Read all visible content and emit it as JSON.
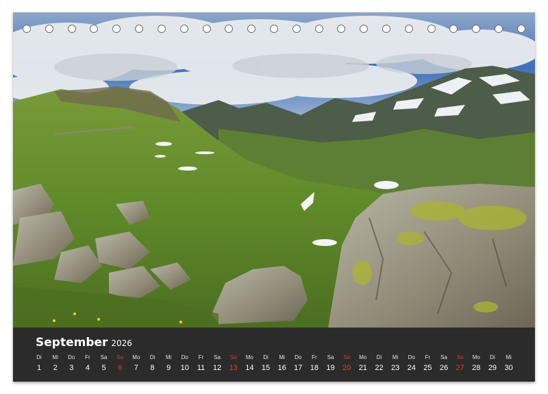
{
  "calendar": {
    "month": "September",
    "year": "2026",
    "sunday_color": "#e23a2d",
    "days": [
      {
        "wd": "Di",
        "n": "1"
      },
      {
        "wd": "Mi",
        "n": "2"
      },
      {
        "wd": "Do",
        "n": "3"
      },
      {
        "wd": "Fr",
        "n": "4"
      },
      {
        "wd": "Sa",
        "n": "5"
      },
      {
        "wd": "So",
        "n": "6"
      },
      {
        "wd": "Mo",
        "n": "7"
      },
      {
        "wd": "Di",
        "n": "8"
      },
      {
        "wd": "Mi",
        "n": "9"
      },
      {
        "wd": "Do",
        "n": "10"
      },
      {
        "wd": "Fr",
        "n": "11"
      },
      {
        "wd": "Sa",
        "n": "12"
      },
      {
        "wd": "So",
        "n": "13"
      },
      {
        "wd": "Mo",
        "n": "14"
      },
      {
        "wd": "Di",
        "n": "15"
      },
      {
        "wd": "Mi",
        "n": "16"
      },
      {
        "wd": "Do",
        "n": "17"
      },
      {
        "wd": "Fr",
        "n": "18"
      },
      {
        "wd": "Sa",
        "n": "19"
      },
      {
        "wd": "So",
        "n": "20"
      },
      {
        "wd": "Mo",
        "n": "21"
      },
      {
        "wd": "Di",
        "n": "22"
      },
      {
        "wd": "Mi",
        "n": "23"
      },
      {
        "wd": "Do",
        "n": "24"
      },
      {
        "wd": "Fr",
        "n": "25"
      },
      {
        "wd": "Sa",
        "n": "26"
      },
      {
        "wd": "So",
        "n": "27"
      },
      {
        "wd": "Mo",
        "n": "28"
      },
      {
        "wd": "Di",
        "n": "29"
      },
      {
        "wd": "Mi",
        "n": "30"
      }
    ]
  },
  "binding_rings": 23
}
